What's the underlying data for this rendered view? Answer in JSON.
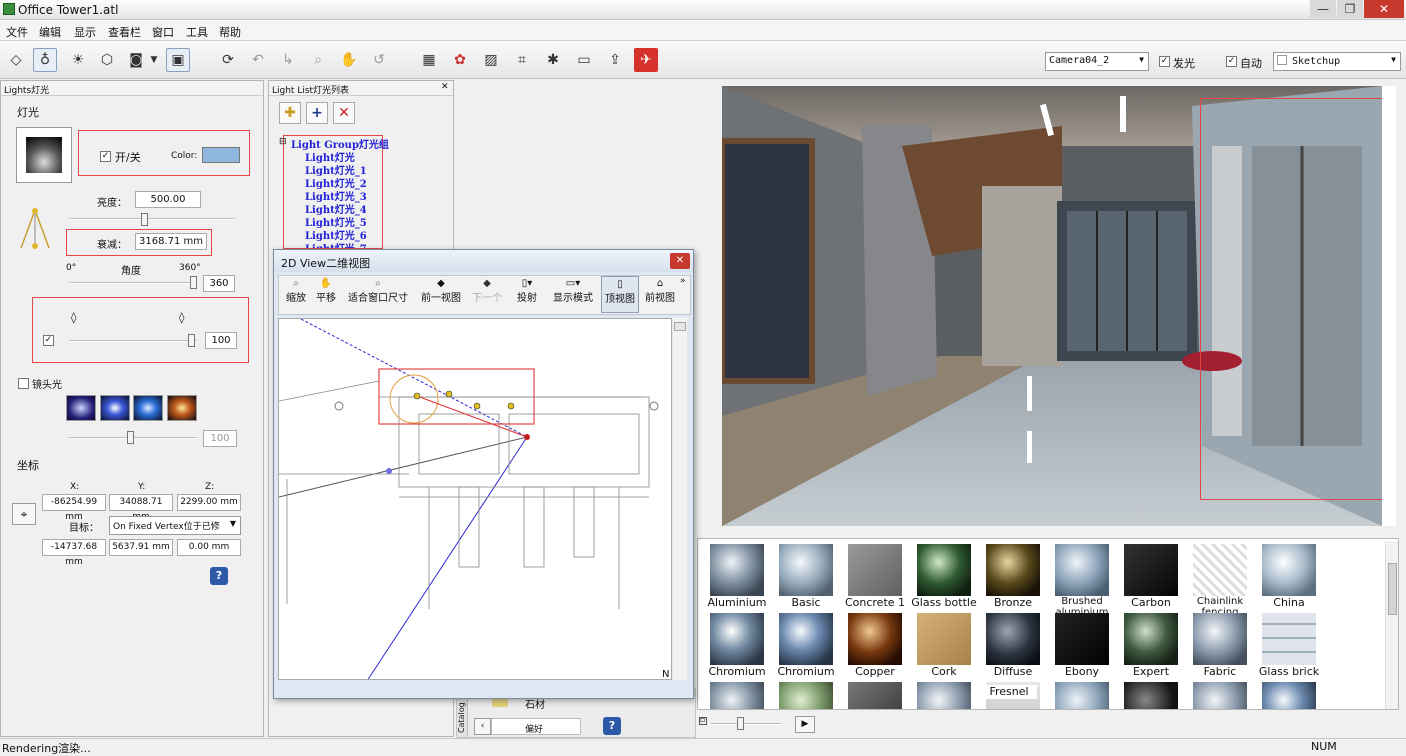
{
  "window": {
    "title": "Office Tower1.atl"
  },
  "menu": [
    "文件",
    "编辑",
    "显示",
    "查看栏",
    "窗口",
    "工具",
    "帮助"
  ],
  "toolbar": {
    "camera_value": "Camera04_2",
    "glow_label": "发光",
    "auto_label": "自动",
    "style_value": "Sketchup"
  },
  "lights_panel": {
    "header": "Lights灯光",
    "section_title": "灯光",
    "onoff_label": "开/关",
    "color_label": "Color:",
    "color_value": "#8fb6dc",
    "brightness_label": "亮度：",
    "brightness_value": "500.00",
    "attenuation_label": "衰减：",
    "attenuation_value": "3168.71 mm",
    "angle_label": "角度",
    "angle_min": "0°",
    "angle_max": "360°",
    "angle_value": "360",
    "softness_value": "100",
    "lensflare_label": "镜头光",
    "lensflare_value": "100",
    "coord_title": "坐标",
    "x_label": "X:",
    "y_label": "Y:",
    "z_label": "Z:",
    "pos_x": "-86254.99 mm",
    "pos_y": "34088.71 mm",
    "pos_z": "2299.00 mm",
    "target_label": "目标：",
    "target_value": "On Fixed Vertex位于已修",
    "tgt_x": "-14737.68 mm",
    "tgt_y": "5637.91 mm",
    "tgt_z": "0.00 mm"
  },
  "light_list": {
    "header": "Light List灯光列表",
    "group": "Light Group灯光组",
    "items": [
      "Light灯光",
      "Light灯光_1",
      "Light灯光_2",
      "Light灯光_3",
      "Light灯光_4",
      "Light灯光_5",
      "Light灯光_6",
      "Light灯光_7"
    ]
  },
  "view2d": {
    "title": "2D View二维视图",
    "tools": [
      "缩放",
      "平移",
      "适合窗口尺寸",
      "前一视图",
      "下一个",
      "投射",
      "显示模式",
      "顶视图",
      "前视图"
    ],
    "corner": "N"
  },
  "materials": {
    "row1": [
      "Aluminium",
      "Basic",
      "Concrete 1",
      "Glass bottle",
      "Bronze",
      "Brushed aluminium",
      "Carbon",
      "Chainlink fencing",
      "China"
    ],
    "row2": [
      "Chromium",
      "Chromium",
      "Copper",
      "Cork",
      "Diffuse",
      "Ebony",
      "Expert",
      "Fabric",
      "Glass brick"
    ],
    "row3_label": "Fresnel",
    "catalog_label": "Catalog",
    "fav_label": "偏好",
    "tree_item": "石材"
  },
  "status": {
    "left": "Rendering渲染...",
    "right": "NUM"
  }
}
